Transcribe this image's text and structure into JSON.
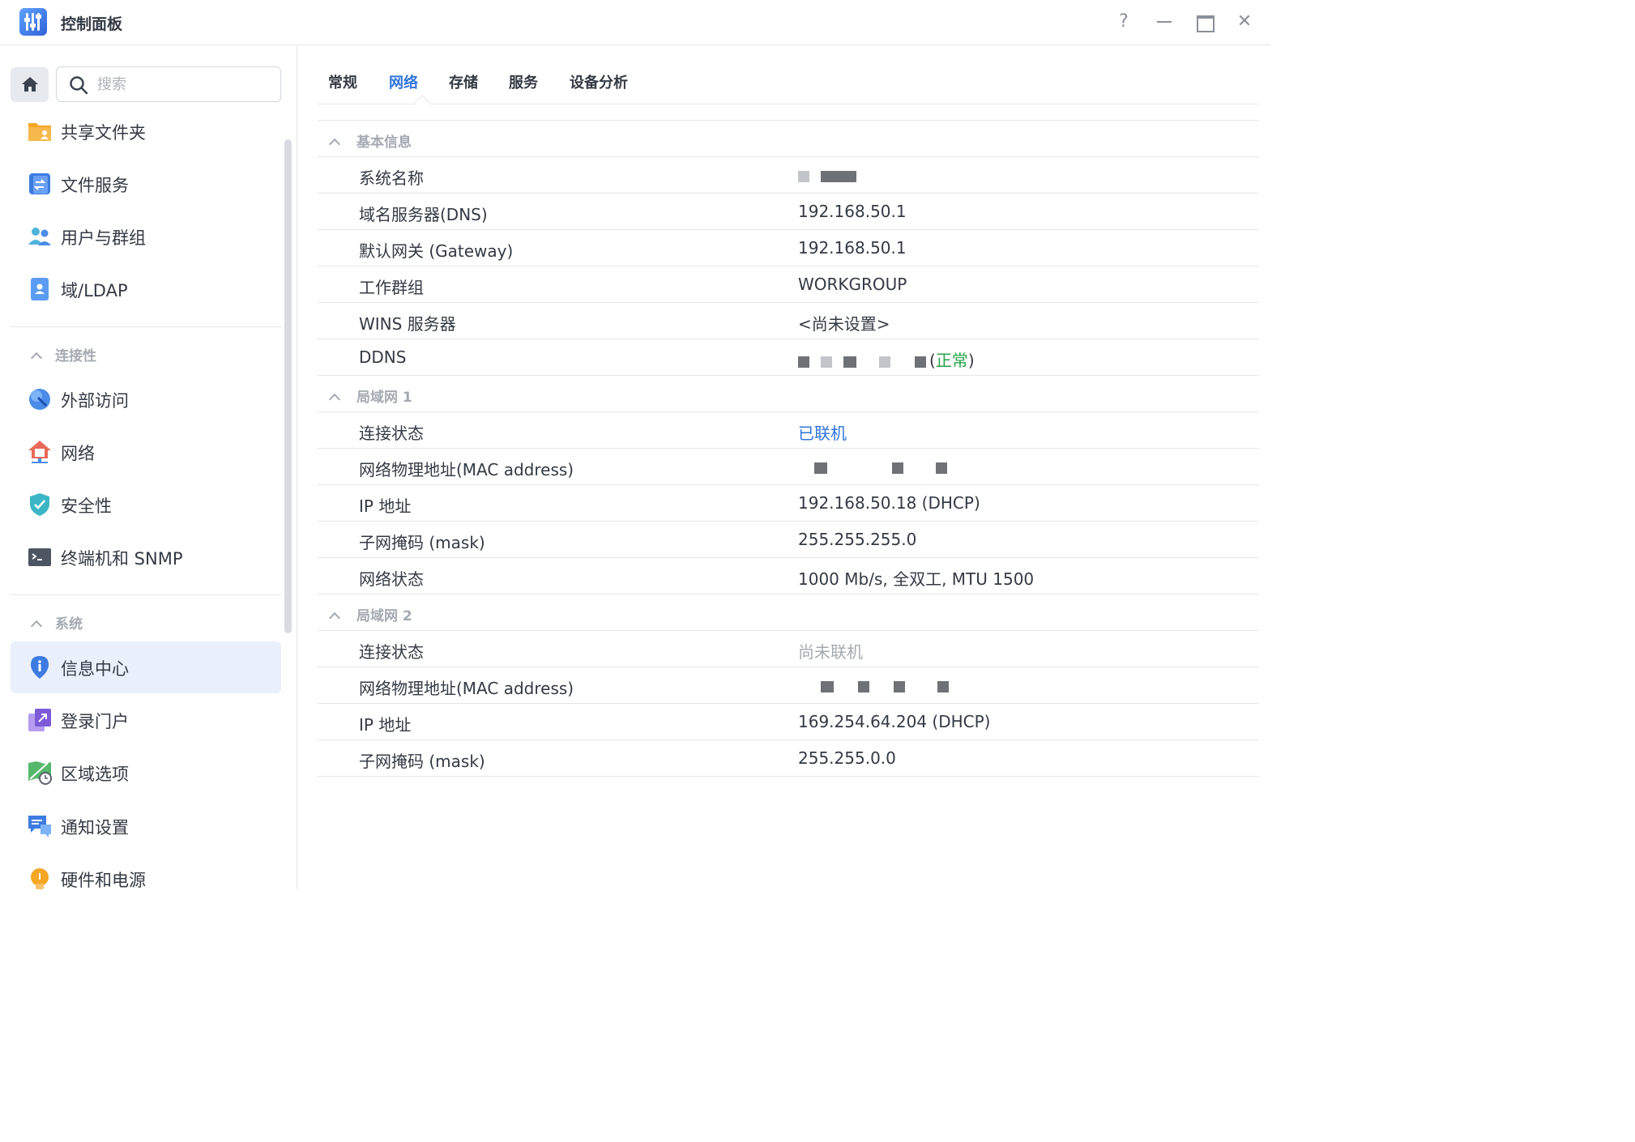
{
  "window": {
    "title": "控制面板",
    "help": "?",
    "close": "✕"
  },
  "sidebar": {
    "search_placeholder": "搜索",
    "items": [
      {
        "label": "共享文件夹",
        "icon": "shared-folder-icon"
      },
      {
        "label": "文件服务",
        "icon": "file-services-icon"
      },
      {
        "label": "用户与群组",
        "icon": "users-groups-icon"
      },
      {
        "label": "域/LDAP",
        "icon": "domain-ldap-icon"
      }
    ],
    "group_connectivity": "连接性",
    "connectivity_items": [
      {
        "label": "外部访问",
        "icon": "external-access-icon"
      },
      {
        "label": "网络",
        "icon": "network-icon"
      },
      {
        "label": "安全性",
        "icon": "security-shield-icon"
      },
      {
        "label": "终端机和 SNMP",
        "icon": "terminal-icon"
      }
    ],
    "group_system": "系统",
    "system_items": [
      {
        "label": "信息中心",
        "icon": "info-center-icon",
        "active": true
      },
      {
        "label": "登录门户",
        "icon": "login-portal-icon"
      },
      {
        "label": "区域选项",
        "icon": "regional-options-icon"
      },
      {
        "label": "通知设置",
        "icon": "notification-icon"
      },
      {
        "label": "硬件和电源",
        "icon": "hardware-power-icon"
      }
    ]
  },
  "tabs": [
    {
      "label": "常规",
      "active": false
    },
    {
      "label": "网络",
      "active": true
    },
    {
      "label": "存储",
      "active": false
    },
    {
      "label": "服务",
      "active": false
    },
    {
      "label": "设备分析",
      "active": false
    }
  ],
  "sections": {
    "basic": {
      "title": "基本信息",
      "rows": [
        {
          "key": "系统名称"
        },
        {
          "key": "域名服务器(DNS)",
          "value": "192.168.50.1"
        },
        {
          "key": "默认网关 (Gateway)",
          "value": "192.168.50.1"
        },
        {
          "key": "工作群组",
          "value": "WORKGROUP"
        },
        {
          "key": "WINS 服务器",
          "value": "<尚未设置>"
        },
        {
          "key": "DDNS",
          "status_prefix": "(",
          "status": "正常",
          "status_suffix": ")"
        }
      ]
    },
    "lan1": {
      "title": "局域网 1",
      "rows": [
        {
          "key": "连接状态",
          "value": "已联机"
        },
        {
          "key": "网络物理地址(MAC address)"
        },
        {
          "key": "IP 地址",
          "value": "192.168.50.18 (DHCP)"
        },
        {
          "key": "子网掩码 (mask)",
          "value": "255.255.255.0"
        },
        {
          "key": "网络状态",
          "value": "1000 Mb/s, 全双工, MTU 1500"
        }
      ]
    },
    "lan2": {
      "title": "局域网 2",
      "rows": [
        {
          "key": "连接状态",
          "value": "尚未联机"
        },
        {
          "key": "网络物理地址(MAC address)"
        },
        {
          "key": "IP 地址",
          "value": "169.254.64.204 (DHCP)"
        },
        {
          "key": "子网掩码 (mask)",
          "value": "255.255.0.0"
        }
      ]
    }
  },
  "colors": {
    "accent": "#2f74dc",
    "status_ok": "#25a345",
    "muted": "#a4aab2",
    "active_bg": "#e9f0fc"
  }
}
